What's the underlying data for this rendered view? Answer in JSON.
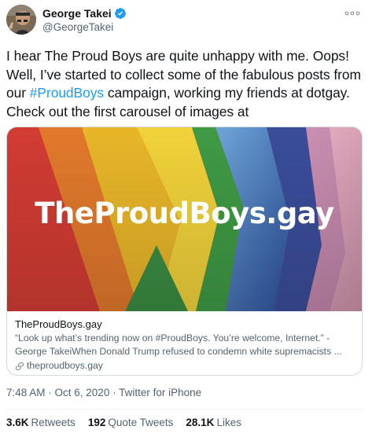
{
  "author": {
    "display_name": "George Takei",
    "handle": "@GeorgeTakei",
    "verified": true,
    "verified_color": "#1d9bf0"
  },
  "tweet": {
    "text_before_hashtag": "I hear The Proud Boys are quite unhappy with me. Oops! Well, I’ve started to collect some of the fabulous posts from our ",
    "hashtag": "#ProudBoys",
    "text_after_hashtag": " campaign, working my friends at dotgay. Check out the first carousel of images at"
  },
  "card": {
    "image_title": "TheProudBoys.gay",
    "title": "TheProudBoys.gay",
    "description": "“Look up what’s trending now on #ProudBoys. You’re welcome, Internet.” - George TakeiWhen Donald Trump refused to condemn white supremacists ...",
    "link_text": "theproudboys.gay",
    "link_icon": "link-icon"
  },
  "meta": {
    "time": "7:48 AM",
    "separator1": " · ",
    "date": "Oct 6, 2020",
    "separator2": " · ",
    "source": "Twitter for iPhone"
  },
  "stats": {
    "retweets_count": "3.6K",
    "retweets_label": "Retweets",
    "quotes_count": "192",
    "quotes_label": "Quote Tweets",
    "likes_count": "28.1K",
    "likes_label": "Likes"
  },
  "colors": {
    "accent": "#1d9bf0",
    "secondary_text": "#536471",
    "primary_text": "#0f1419",
    "border": "#cfd9de"
  }
}
